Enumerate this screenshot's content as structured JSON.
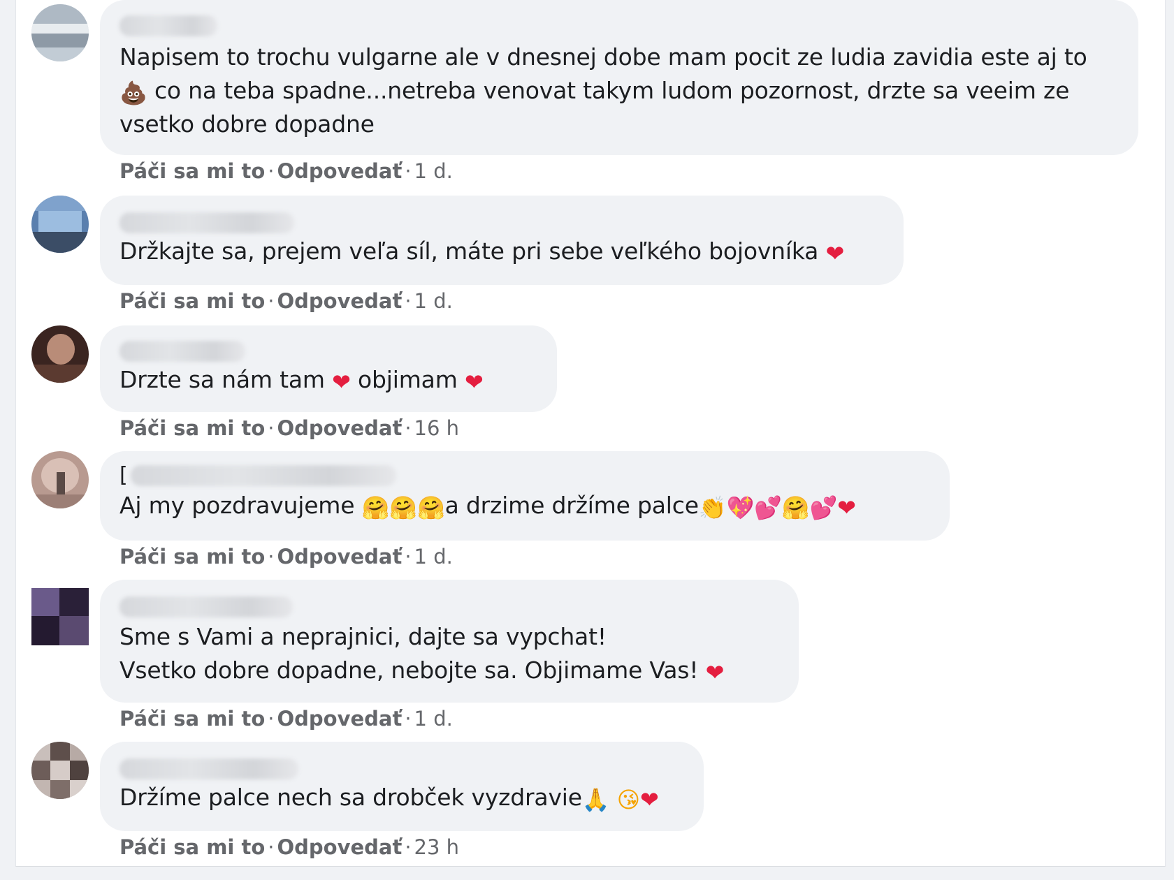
{
  "actions": {
    "like": "Páči sa mi to",
    "reply": "Odpovedať",
    "separator": "·"
  },
  "comments": [
    {
      "lines": [
        "Napisem to trochu vulgarne ale v dnesnej dobe mam pocit ze ludia zavidia este aj to",
        "co na teba spadne...netreba venovat takym ludom pozornost, drzte sa veeim ze",
        "vsetko dobre dopadne"
      ],
      "time": "1 d."
    },
    {
      "lines": [
        "Držkajte sa, prejem veľa síl, máte pri sebe veľkého bojovníka"
      ],
      "time": "1 d."
    },
    {
      "lines": [
        "Drzte sa nám tam",
        "objimam"
      ],
      "time": "16 h"
    },
    {
      "initial": "[",
      "lines": [
        "Aj my pozdravujeme",
        "a drzime držíme palce"
      ],
      "time": "1 d."
    },
    {
      "lines": [
        "Sme s Vami a neprajnici, dajte sa vypchat!",
        "Vsetko dobre dopadne, nebojte sa. Objimame Vas!"
      ],
      "time": "1 d."
    },
    {
      "lines": [
        "Držíme palce nech sa drobček vyzdravie"
      ],
      "time": "23 h"
    }
  ],
  "emoji": {
    "heart": "❤",
    "poo": "💩",
    "hug": "🤗",
    "clap": "👏",
    "sparkling_heart": "💖",
    "two_hearts": "💕",
    "pray": "🙏",
    "kiss": "😘"
  },
  "colors": {
    "bubble": "#f0f2f5",
    "text": "#1c1e21",
    "meta": "#65676b",
    "heart": "#e41e3f"
  }
}
